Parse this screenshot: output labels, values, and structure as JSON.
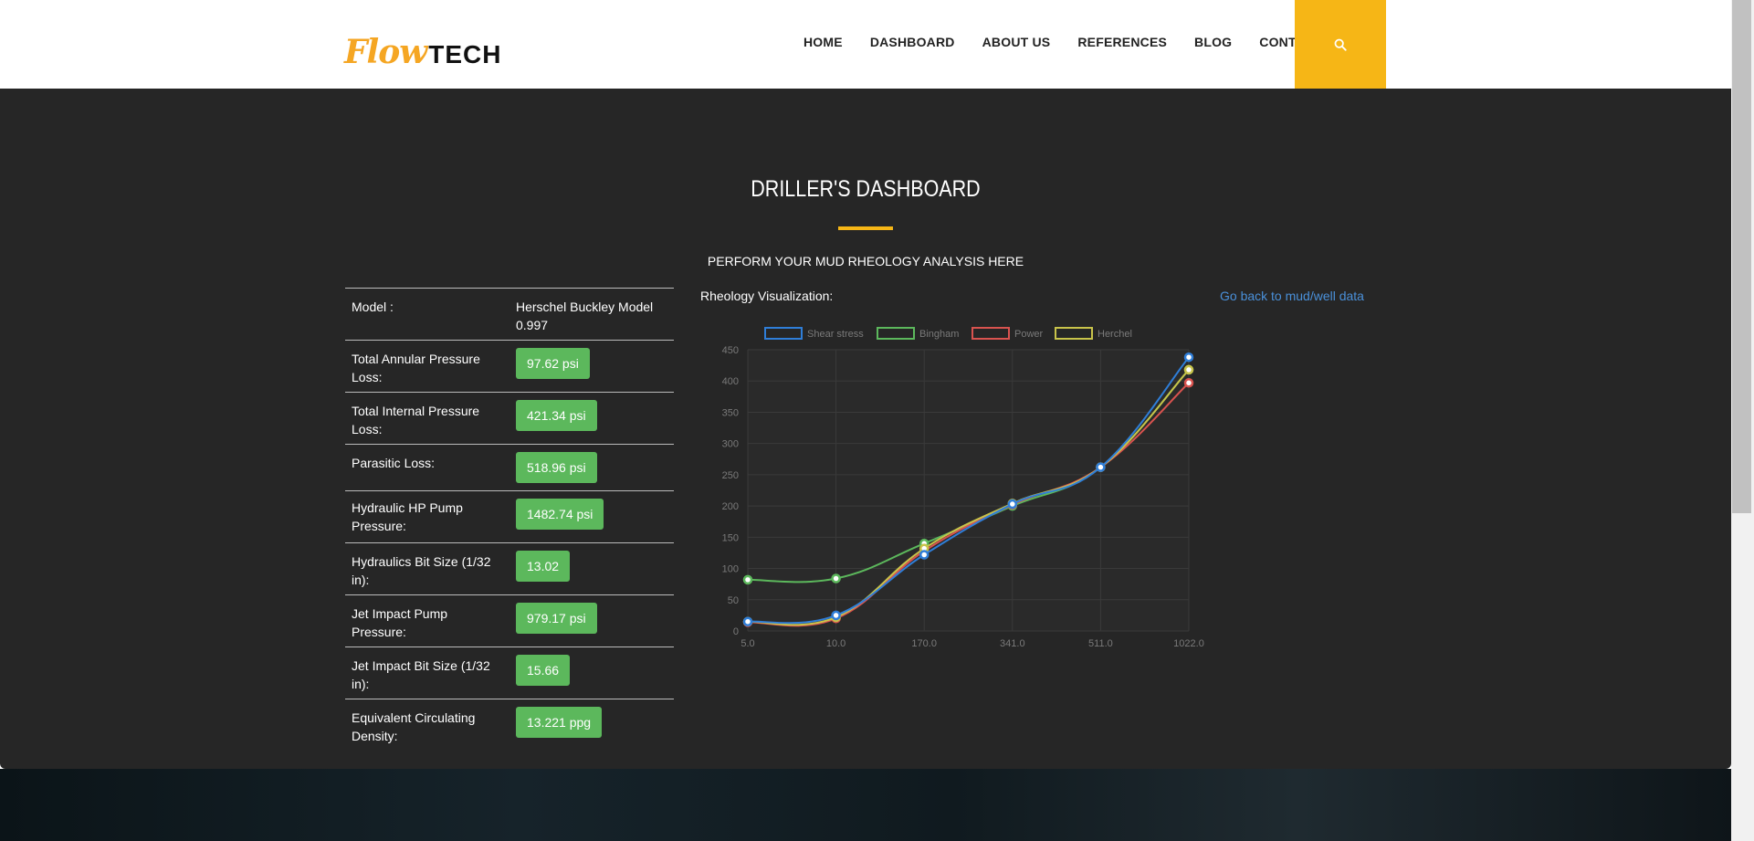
{
  "header": {
    "logo": {
      "part1": "Flow",
      "part2": "TECH"
    },
    "nav": [
      "HOME",
      "DASHBOARD",
      "ABOUT US",
      "REFERENCES",
      "BLOG",
      "CONTACT"
    ],
    "search_icon": "search-icon",
    "accent_color": "#f6b616"
  },
  "main": {
    "title": "DRILLER'S DASHBOARD",
    "subtitle": "PERFORM YOUR MUD RHEOLOGY ANALYSIS HERE",
    "viz_label": "Rheology Visualization:",
    "back_link": "Go back to mud/well data"
  },
  "results": {
    "model_label": "Model :",
    "model_value": "Herschel Buckley Model 0.997",
    "rows": [
      {
        "label": "Total Annular Pressure Loss:",
        "value": "97.62 psi"
      },
      {
        "label": "Total Internal Pressure Loss:",
        "value": "421.34 psi"
      },
      {
        "label": "Parasitic Loss:",
        "value": "518.96 psi"
      },
      {
        "label": "Hydraulic HP Pump Pressure:",
        "value": "1482.74 psi"
      },
      {
        "label": "Hydraulics Bit Size (1/32 in):",
        "value": "13.02"
      },
      {
        "label": "Jet Impact Pump Pressure:",
        "value": "979.17 psi"
      },
      {
        "label": "Jet Impact Bit Size (1/32 in):",
        "value": "15.66"
      },
      {
        "label": "Equivalent Circulating Density:",
        "value": "13.221 ppg"
      }
    ],
    "badge_color": "#5cb85c"
  },
  "chart_data": {
    "type": "line",
    "categories": [
      "5.0",
      "10.0",
      "170.0",
      "341.0",
      "511.0",
      "1022.0"
    ],
    "ylim": [
      0,
      450
    ],
    "yticks": [
      0,
      50,
      100,
      150,
      200,
      250,
      300,
      350,
      400,
      450
    ],
    "grid": true,
    "legend_position": "top",
    "series": [
      {
        "name": "Shear stress",
        "color": "#2f7ed8",
        "values": [
          15,
          25,
          122,
          203,
          262,
          438
        ]
      },
      {
        "name": "Bingham",
        "color": "#5cb85c",
        "values": [
          82,
          84,
          140,
          200,
          262,
          418
        ]
      },
      {
        "name": "Power",
        "color": "#d9534f",
        "values": [
          14,
          20,
          128,
          202,
          262,
          397
        ]
      },
      {
        "name": "Herchel",
        "color": "#c8c34a",
        "values": [
          15,
          22,
          132,
          204,
          262,
          418
        ]
      }
    ]
  }
}
